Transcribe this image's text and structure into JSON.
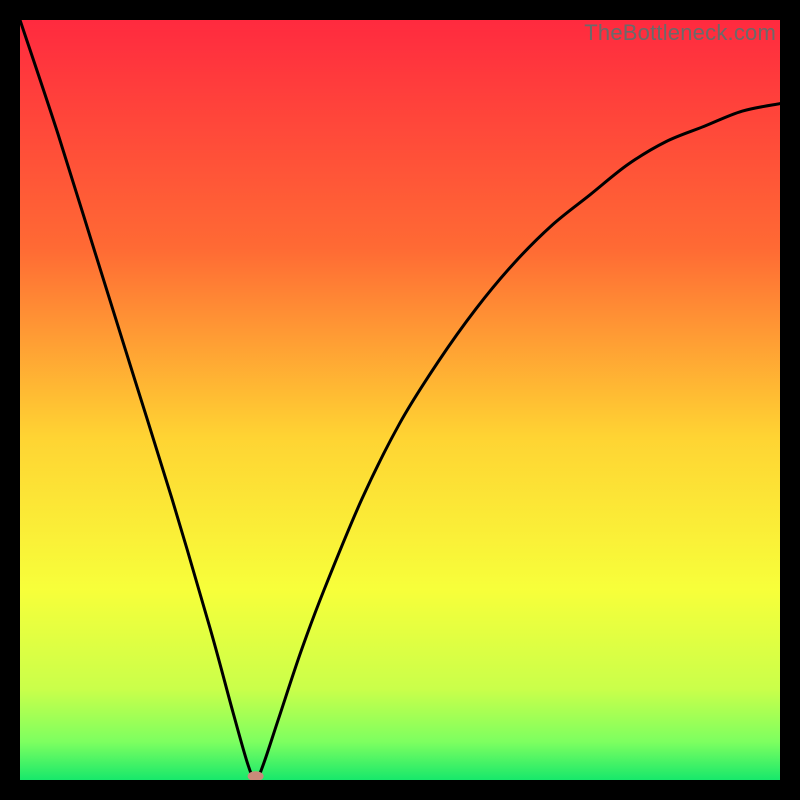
{
  "watermark": {
    "text": "TheBottleneck.com"
  },
  "chart_data": {
    "type": "line",
    "title": "",
    "xlabel": "",
    "ylabel": "",
    "xlim": [
      0,
      100
    ],
    "ylim": [
      0,
      100
    ],
    "grid": false,
    "gradient_stops": [
      {
        "offset": 0,
        "color": "#ff2a3f"
      },
      {
        "offset": 0.3,
        "color": "#ff6a34"
      },
      {
        "offset": 0.55,
        "color": "#ffd433"
      },
      {
        "offset": 0.75,
        "color": "#f7ff3a"
      },
      {
        "offset": 0.88,
        "color": "#caff4a"
      },
      {
        "offset": 0.95,
        "color": "#7dff60"
      },
      {
        "offset": 1.0,
        "color": "#17e86b"
      }
    ],
    "series": [
      {
        "name": "bottleneck-curve",
        "color": "#000000",
        "x": [
          0,
          5,
          10,
          15,
          20,
          25,
          28,
          30,
          31,
          32,
          34,
          37,
          40,
          45,
          50,
          55,
          60,
          65,
          70,
          75,
          80,
          85,
          90,
          95,
          100
        ],
        "values": [
          100,
          85,
          69,
          53,
          37,
          20,
          9,
          2,
          0,
          2,
          8,
          17,
          25,
          37,
          47,
          55,
          62,
          68,
          73,
          77,
          81,
          84,
          86,
          88,
          89
        ]
      }
    ],
    "marker": {
      "x": 31,
      "y": 0.5,
      "rx": 8,
      "ry": 5,
      "fill": "#c98b7a"
    }
  }
}
